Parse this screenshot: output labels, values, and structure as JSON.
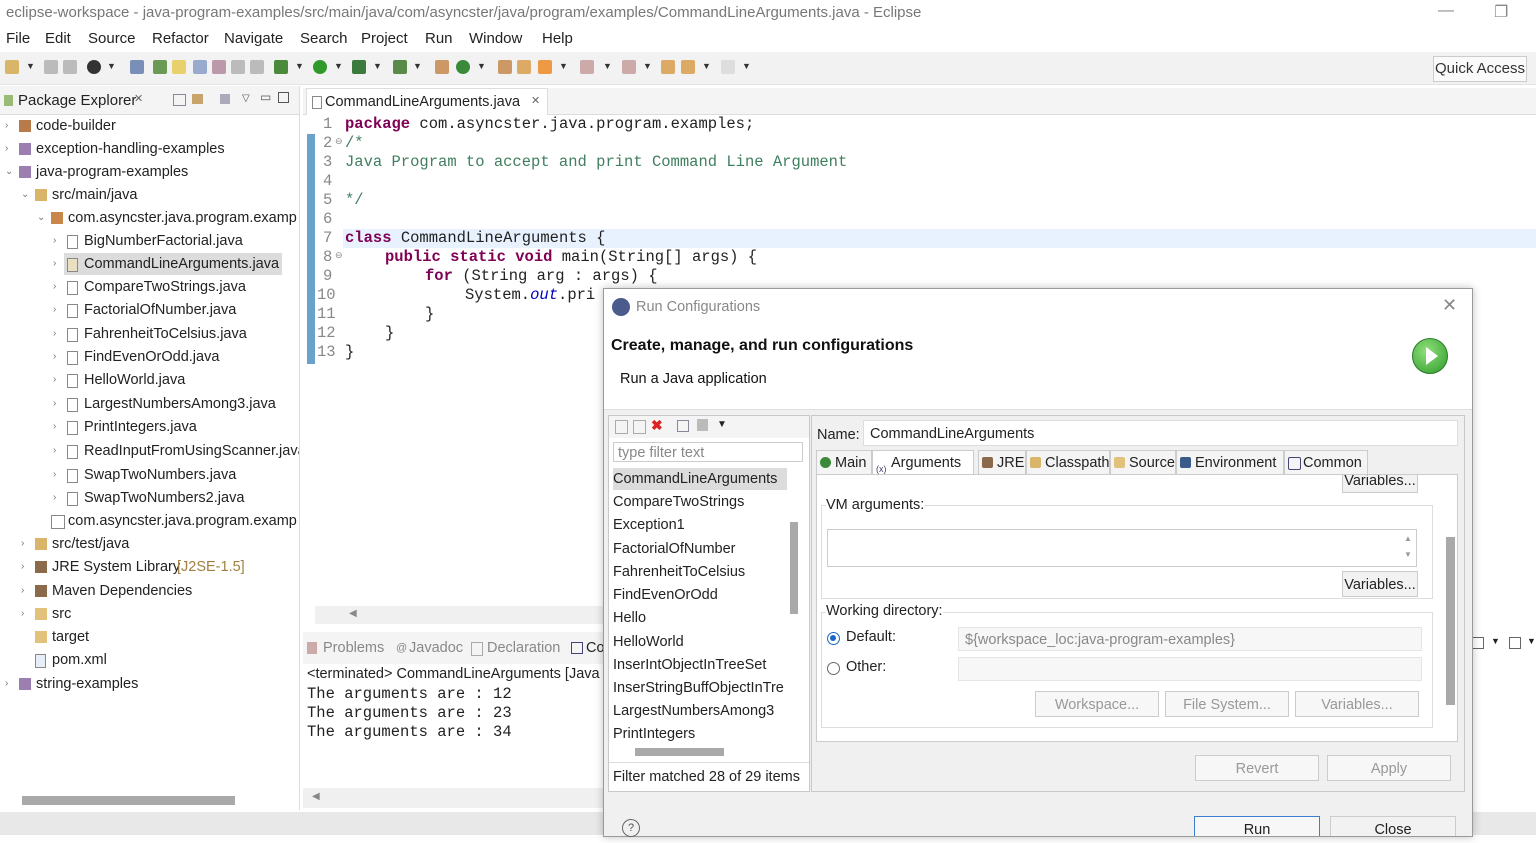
{
  "window": {
    "title": "eclipse-workspace - java-program-examples/src/main/java/com/asyncster/java/program/examples/CommandLineArguments.java - Eclipse"
  },
  "menu": [
    "File",
    "Edit",
    "Source",
    "Refactor",
    "Navigate",
    "Search",
    "Project",
    "Run",
    "Window",
    "Help"
  ],
  "toolbar": {
    "quick_access": "Quick Access"
  },
  "package_explorer": {
    "tab_label": "Package Explorer",
    "items": [
      {
        "label": "code-builder"
      },
      {
        "label": "exception-handling-examples"
      },
      {
        "label": "java-program-examples"
      },
      {
        "label": "src/main/java"
      },
      {
        "label": "com.asyncster.java.program.examp"
      },
      {
        "label": "BigNumberFactorial.java"
      },
      {
        "label": "CommandLineArguments.java"
      },
      {
        "label": "CompareTwoStrings.java"
      },
      {
        "label": "FactorialOfNumber.java"
      },
      {
        "label": "FahrenheitToCelsius.java"
      },
      {
        "label": "FindEvenOrOdd.java"
      },
      {
        "label": "HelloWorld.java"
      },
      {
        "label": "LargestNumbersAmong3.java"
      },
      {
        "label": "PrintIntegers.java"
      },
      {
        "label": "ReadInputFromUsingScanner.java"
      },
      {
        "label": "SwapTwoNumbers.java"
      },
      {
        "label": "SwapTwoNumbers2.java"
      },
      {
        "label": "com.asyncster.java.program.examp"
      },
      {
        "label": "src/test/java"
      },
      {
        "label": "JRE System Library",
        "suffix": "[J2SE-1.5]"
      },
      {
        "label": "Maven Dependencies"
      },
      {
        "label": "src"
      },
      {
        "label": "target"
      },
      {
        "label": "pom.xml"
      },
      {
        "label": "string-examples"
      }
    ]
  },
  "editor": {
    "tab_label": "CommandLineArguments.java",
    "line_numbers": [
      "1",
      "2",
      "3",
      "4",
      "5",
      "6",
      "7",
      "8",
      "9",
      "10",
      "11",
      "12",
      "13"
    ],
    "lines": {
      "l1_kw": "package",
      "l1_rest": " com.asyncster.java.program.examples;",
      "l2": "/*",
      "l3": "Java Program to accept and print Command Line Argument",
      "l5": "*/",
      "l7_kw": "class",
      "l7_rest": " CommandLineArguments {",
      "l8_kw": "public static void",
      "l8_rest": " main(String[] args) {",
      "l9_kw": "for",
      "l9_rest": " (String arg : args) {",
      "l10_a": "System.",
      "l10_b": "out",
      "l10_c": ".pri",
      "l11": "}",
      "l12": "}",
      "l13": "}"
    }
  },
  "console": {
    "tabs": [
      "Problems",
      "Javadoc",
      "Declaration",
      "Co"
    ],
    "terminated": "<terminated> CommandLineArguments [Java",
    "output": [
      "The arguments are : 12",
      "The arguments are : 23",
      "The arguments are : 34"
    ]
  },
  "dialog": {
    "title": "Run Configurations",
    "header_title": "Create, manage, and run configurations",
    "header_subtitle": "Run a Java application",
    "filter_placeholder": "type filter text",
    "configs": [
      "CommandLineArguments",
      "CompareTwoStrings",
      "Exception1",
      "FactorialOfNumber",
      "FahrenheitToCelsius",
      "FindEvenOrOdd",
      "Hello",
      "HelloWorld",
      "InserIntObjectInTreeSet",
      "InserStringBuffObjectInTre",
      "LargestNumbersAmong3",
      "PrintIntegers"
    ],
    "filter_message": "Filter matched 28 of 29 items",
    "name_label": "Name:",
    "name_value": "CommandLineArguments",
    "tabs": [
      "Main",
      "Arguments",
      "JRE",
      "Classpath",
      "Source",
      "Environment",
      "Common"
    ],
    "variables_label": "Variables...",
    "vm_arguments_label": "VM arguments:",
    "working_directory_label": "Working directory:",
    "default_label": "Default:",
    "default_value": "${workspace_loc:java-program-examples}",
    "other_label": "Other:",
    "workspace_btn": "Workspace...",
    "filesystem_btn": "File System...",
    "revert_btn": "Revert",
    "apply_btn": "Apply",
    "run_btn": "Run",
    "close_btn": "Close",
    "help": "?"
  }
}
